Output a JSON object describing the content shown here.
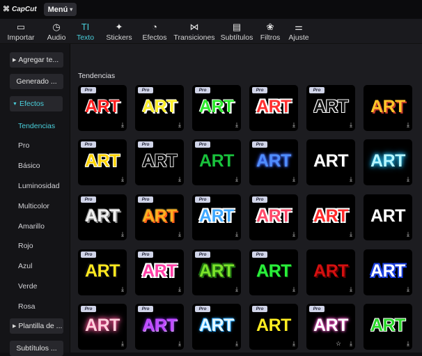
{
  "app": {
    "logo": "CapCut",
    "menu_label": "Menú"
  },
  "toolbar": [
    {
      "label": "Importar",
      "icon": "import-icon",
      "glyph": "▭"
    },
    {
      "label": "Audio",
      "icon": "audio-icon",
      "glyph": "◷"
    },
    {
      "label": "Texto",
      "icon": "text-icon",
      "glyph": "TI",
      "active": true
    },
    {
      "label": "Stickers",
      "icon": "sticker-icon",
      "glyph": "✦"
    },
    {
      "label": "Efectos",
      "icon": "effects-icon",
      "glyph": "◔"
    },
    {
      "label": "Transiciones",
      "icon": "transitions-icon",
      "glyph": "⋈"
    },
    {
      "label": "Subtítulos",
      "icon": "subtitles-icon",
      "glyph": "▤"
    },
    {
      "label": "Filtros",
      "icon": "filters-icon",
      "glyph": "❀"
    },
    {
      "label": "Ajuste",
      "icon": "adjust-icon",
      "glyph": "⚌"
    }
  ],
  "sidebar": {
    "agregar": "Agregar te...",
    "generado": "Generado ...",
    "efectos": "Efectos",
    "sub_items": [
      "Tendencias",
      "Pro",
      "Básico",
      "Luminosidad",
      "Multicolor",
      "Amarillo",
      "Rojo",
      "Azul",
      "Verde",
      "Rosa"
    ],
    "plantilla": "Plantilla de ...",
    "subtitulos": "Subtítulos ..."
  },
  "main": {
    "section_title": "Tendencias"
  },
  "card_text": "ART",
  "pro_badge": "Pro",
  "download_icon": "download-icon",
  "star_icon": "star-icon",
  "colors": {
    "accent": "#4ad0dc",
    "background": "#1c1c20"
  }
}
